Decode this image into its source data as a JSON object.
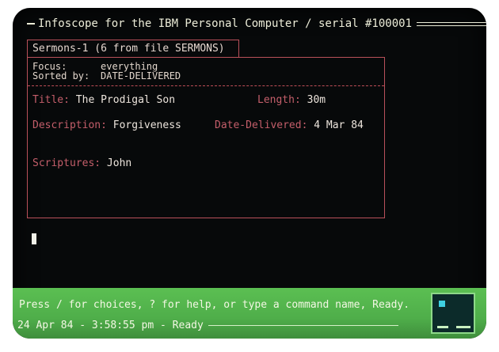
{
  "window": {
    "title": "Infoscope for the IBM Personal Computer / serial #100001"
  },
  "tab": {
    "label": "Sermons-1 (6 from file SERMONS)"
  },
  "query": {
    "focus_label": "Focus:",
    "focus_value": "everything",
    "sort_label": "Sorted by:",
    "sort_value": "DATE-DELIVERED"
  },
  "record": {
    "title_label": "Title:",
    "title_value": "The Prodigal Son",
    "length_label": "Length:",
    "length_value": "30m",
    "description_label": "Description:",
    "description_value": "Forgiveness",
    "date_label": "Date-Delivered:",
    "date_value": "4 Mar 84",
    "scriptures_label": "Scriptures:",
    "scriptures_value": "John"
  },
  "status": {
    "prompt": "Press / for choices, ? for help, or type a command name, Ready.",
    "timestamp": "24 Apr 84 - 3:58:55 pm - Ready"
  },
  "colors": {
    "screen_bg": "#07090a",
    "frame_red": "#b9505a",
    "status_green": "#4fae4a",
    "text_light": "#ececd8"
  }
}
